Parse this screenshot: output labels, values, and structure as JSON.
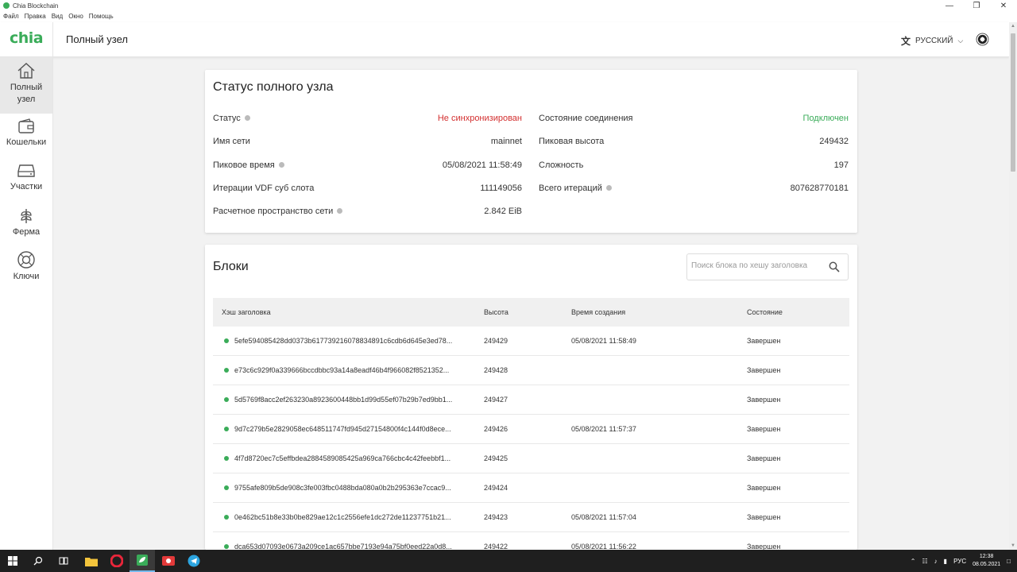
{
  "window": {
    "title": "Chia Blockchain",
    "menu": [
      "Файл",
      "Правка",
      "Вид",
      "Окно",
      "Помощь"
    ]
  },
  "header": {
    "logo": "chia",
    "title": "Полный узел",
    "language": "РУССКИЙ"
  },
  "sidebar": {
    "items": [
      {
        "label": "Полный узел",
        "icon": "home-icon",
        "active": true
      },
      {
        "label": "Кошельки",
        "icon": "wallet-icon",
        "active": false
      },
      {
        "label": "Участки",
        "icon": "plots-icon",
        "active": false
      },
      {
        "label": "Ферма",
        "icon": "farm-icon",
        "active": false
      },
      {
        "label": "Ключи",
        "icon": "keys-icon",
        "active": false
      }
    ]
  },
  "status": {
    "title": "Статус полного узла",
    "left": [
      {
        "label": "Статус",
        "value": "Не синхронизирован",
        "help": true
      },
      {
        "label": "Имя сети",
        "value": "mainnet",
        "help": false
      },
      {
        "label": "Пиковое время",
        "value": "05/08/2021 11:58:49",
        "help": true
      },
      {
        "label": "Итерации VDF суб слота",
        "value": "111149056",
        "help": false
      },
      {
        "label": "Расчетное пространство сети",
        "value": "2.842 EiB",
        "help": true
      }
    ],
    "right": [
      {
        "label": "Состояние соединения",
        "value": "Подключен",
        "help": false
      },
      {
        "label": "Пиковая высота",
        "value": "249432",
        "help": false
      },
      {
        "label": "Сложность",
        "value": "197",
        "help": false
      },
      {
        "label": "Всего итераций",
        "value": "807628770181",
        "help": true
      }
    ],
    "colors": {
      "not_synced": "#d32f2f",
      "connected": "#3aac59"
    }
  },
  "blocks": {
    "title": "Блоки",
    "search_placeholder": "Поиск блока по хешу заголовка",
    "columns": [
      "Хэш заголовка",
      "Высота",
      "Время создания",
      "Состояние"
    ],
    "rows": [
      {
        "hash": "5efe594085428dd0373b617739216078834891c6cdb6d645e3ed78...",
        "height": "249429",
        "time": "05/08/2021 11:58:49",
        "state": "Завершен"
      },
      {
        "hash": "e73c6c929f0a339666bccdbbc93a14a8eadf46b4f966082f8521352...",
        "height": "249428",
        "time": "",
        "state": "Завершен"
      },
      {
        "hash": "5d5769f8acc2ef263230a8923600448bb1d99d55ef07b29b7ed9bb1...",
        "height": "249427",
        "time": "",
        "state": "Завершен"
      },
      {
        "hash": "9d7c279b5e2829058ec648511747fd945d27154800f4c144f0d8ece...",
        "height": "249426",
        "time": "05/08/2021 11:57:37",
        "state": "Завершен"
      },
      {
        "hash": "4f7d8720ec7c5effbdea2884589085425a969ca766cbc4c42feebbf1...",
        "height": "249425",
        "time": "",
        "state": "Завершен"
      },
      {
        "hash": "9755afe809b5de908c3fe003fbc0488bda080a0b2b295363e7ccac9...",
        "height": "249424",
        "time": "",
        "state": "Завершен"
      },
      {
        "hash": "0e462bc51b8e33b0be829ae12c1c2556efe1dc272de11237751b21...",
        "height": "249423",
        "time": "05/08/2021 11:57:04",
        "state": "Завершен"
      },
      {
        "hash": "dca653d07093e0673a209ce1ac657bbe7193e94a75bf0eed22a0d8...",
        "height": "249422",
        "time": "05/08/2021 11:56:22",
        "state": "Завершен"
      }
    ]
  },
  "taskbar": {
    "lang": "РУС",
    "time": "12:38",
    "date": "08.05.2021"
  }
}
